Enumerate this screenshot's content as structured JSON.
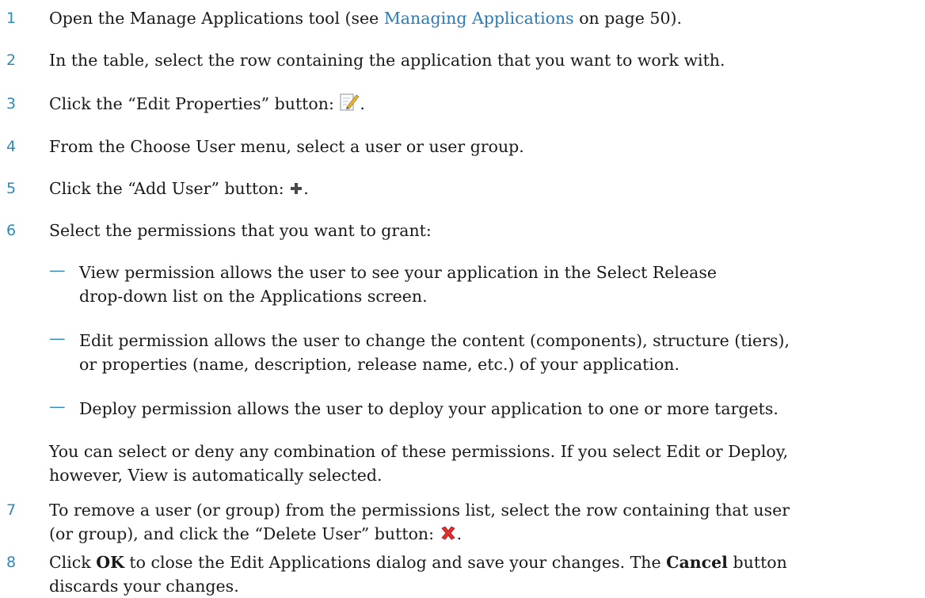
{
  "steps": [
    {
      "num": "1",
      "pre": "Open the Manage Applications tool (see ",
      "link": "Managing Applications",
      "post": " on page 50)."
    },
    {
      "num": "2",
      "text": "In the table, select the row containing the application that you want to work with."
    },
    {
      "num": "3",
      "pre": "Click the “Edit Properties” button: ",
      "post": ".",
      "icon": "edit-properties-icon"
    },
    {
      "num": "4",
      "text": "From the Choose User menu, select a user or user group."
    },
    {
      "num": "5",
      "pre": "Click the “Add User” button: ",
      "post": ".",
      "icon": "add-user-icon"
    },
    {
      "num": "6",
      "text": "Select the permissions that you want to grant:"
    },
    {
      "num": "7",
      "line1": "To remove a user (or group) from the permissions list, select the row containing that user",
      "pre2": "(or group), and click the “Delete User” button: ",
      "post2": ".",
      "icon": "delete-user-icon"
    },
    {
      "num": "8",
      "pre": "Click ",
      "ok": "OK",
      "mid": " to close the Edit Applications dialog and save your changes. The ",
      "cancel": "Cancel",
      "post": " button",
      "line2": "discards your changes."
    }
  ],
  "permissions": [
    {
      "dash": "—",
      "line1": "View permission allows the user to see your application in the Select Release",
      "line2": "drop-down list on the Applications screen."
    },
    {
      "dash": "—",
      "line1": "Edit permission allows the user to change the content (components), structure (tiers),",
      "line2": "or properties (name, description, release name, etc.) of your application."
    },
    {
      "dash": "—",
      "line1": "Deploy permission allows the user to deploy your application to one or more targets."
    }
  ],
  "note": {
    "line1": "You can select or deny any combination of these permissions. If you select Edit or Deploy,",
    "line2": "however, View is automatically selected."
  },
  "colors": {
    "accent": "#2e8ab8",
    "link": "#2a7bb8",
    "text": "#1a1a1a",
    "delete": "#e03030"
  }
}
